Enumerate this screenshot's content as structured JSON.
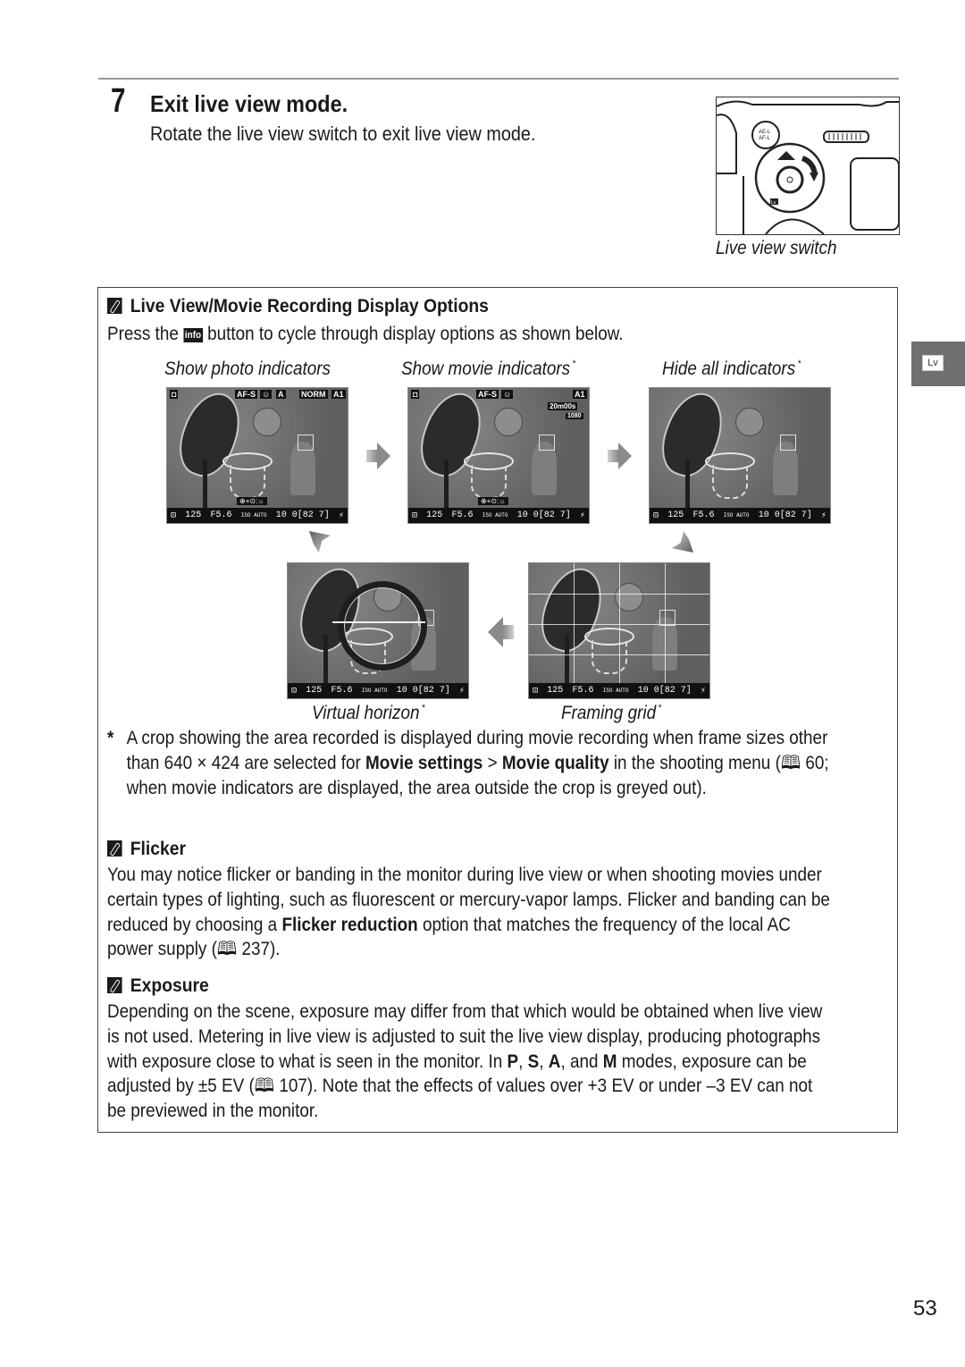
{
  "step": {
    "number": "7",
    "title": "Exit live view mode.",
    "description": "Rotate the live view switch to exit live view mode."
  },
  "camera_figure": {
    "caption": "Live view switch",
    "lv_label": "Lv",
    "button_label": "AE-L AF-L"
  },
  "display_options": {
    "heading": "Live View/Movie Recording Display Options",
    "intro_before": "Press the",
    "info_icon": "info",
    "intro_after": "button to cycle through display options as shown below.",
    "screens": [
      {
        "label": "Show photo indicators",
        "asterisk": "",
        "top": [
          "AF-S",
          "☺",
          "A",
          "NORM",
          "A1"
        ],
        "bottom": [
          "⊡",
          "125",
          "F5.6",
          "ISO AUTO",
          "10 0[82 7]",
          "⚡"
        ]
      },
      {
        "label": "Show movie indicators",
        "asterisk": "*",
        "top": [
          "AF-S",
          "☺",
          "A1",
          "20m00s",
          "1080"
        ],
        "bottom": [
          "⊡",
          "125",
          "F5.6",
          "ISO AUTO",
          "10 0[82 7]",
          "⚡"
        ]
      },
      {
        "label": "Hide all indicators",
        "asterisk": "*",
        "bottom": [
          "⊡",
          "125",
          "F5.6",
          "ISO AUTO",
          "10 0[82 7]",
          "⚡"
        ]
      },
      {
        "label": "Virtual horizon",
        "asterisk": "*",
        "bottom": [
          "⊡",
          "125",
          "F5.6",
          "ISO AUTO",
          "10 0[82 7]",
          "⚡"
        ]
      },
      {
        "label": "Framing grid",
        "asterisk": "*",
        "bottom": [
          "⊡",
          "125",
          "F5.6",
          "ISO AUTO",
          "10 0[82 7]",
          "⚡"
        ]
      }
    ],
    "footnote_mark": "*",
    "footnote_1": "A crop showing the area recorded is displayed during movie recording when frame sizes other than 640 × 424 are selected for",
    "footnote_bold_1": "Movie settings",
    "footnote_sep": " > ",
    "footnote_bold_2": "Movie quality",
    "footnote_2": "in the shooting menu (🕮 60; when movie indicators are displayed, the area outside the crop is greyed out)."
  },
  "flicker": {
    "heading": "Flicker",
    "text_1": "You may notice flicker or banding in the monitor during live view or when shooting movies under certain types of lighting, such as fluorescent or mercury-vapor lamps.  Flicker and banding can be reduced by choosing a",
    "bold": "Flicker reduction",
    "text_2": "option that matches the frequency of the local AC power supply (🕮 237)."
  },
  "exposure": {
    "heading": "Exposure",
    "text_1": "Depending on the scene, exposure may differ from that which would be obtained when live view is not used. Metering in live view is adjusted to suit the live view display, producing photographs with exposure close to what is seen in the monitor.  In",
    "mode_p": "P",
    "mode_s": "S",
    "mode_a": "A",
    "mode_m": "M",
    "text_2": "modes, exposure can be adjusted by ±5 EV (🕮 107).  Note that the effects of values over +3 EV or under –3 EV can not be previewed in the monitor."
  },
  "side_tab": {
    "label": "Lv"
  },
  "page_number": "53"
}
